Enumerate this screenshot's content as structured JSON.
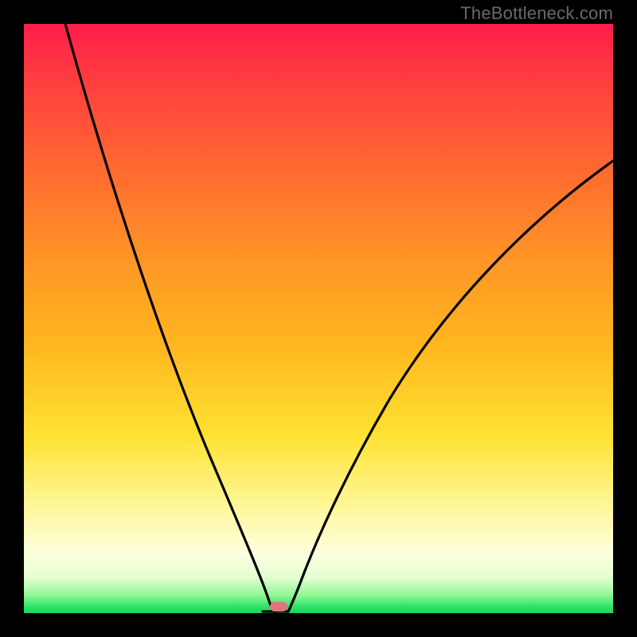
{
  "watermark": "TheBottleneck.com",
  "marker": {
    "color": "#e0747d"
  },
  "chart_data": {
    "type": "line",
    "title": "",
    "xlabel": "",
    "ylabel": "",
    "xlim": [
      0,
      100
    ],
    "ylim": [
      0,
      100
    ],
    "gradient_stops": [
      {
        "pct": 0,
        "color": "#ff1d4a"
      },
      {
        "pct": 25,
        "color": "#ff6a30"
      },
      {
        "pct": 55,
        "color": "#ffb81f"
      },
      {
        "pct": 82,
        "color": "#fff79a"
      },
      {
        "pct": 97,
        "color": "#8ff793"
      },
      {
        "pct": 100,
        "color": "#1dd561"
      }
    ],
    "series": [
      {
        "name": "left-branch",
        "x": [
          7,
          10,
          14,
          18,
          22,
          26,
          30,
          34,
          36,
          38,
          39,
          40,
          41,
          42
        ],
        "y": [
          100,
          90,
          78,
          66,
          55,
          44,
          33,
          22,
          16,
          10,
          6,
          3,
          1,
          0
        ]
      },
      {
        "name": "right-branch",
        "x": [
          44,
          45,
          46,
          48,
          51,
          55,
          60,
          66,
          73,
          81,
          90,
          100
        ],
        "y": [
          0,
          1,
          3,
          7,
          13,
          21,
          30,
          40,
          50,
          60,
          69,
          77
        ]
      }
    ],
    "minimum_marker": {
      "x": 43,
      "y": 0
    },
    "interpretation": "V-shaped curve with sharp minimum near x≈43; y≈0 at minimum, rises steeply to both sides; background color encodes y-value (red=high, green=low)."
  }
}
